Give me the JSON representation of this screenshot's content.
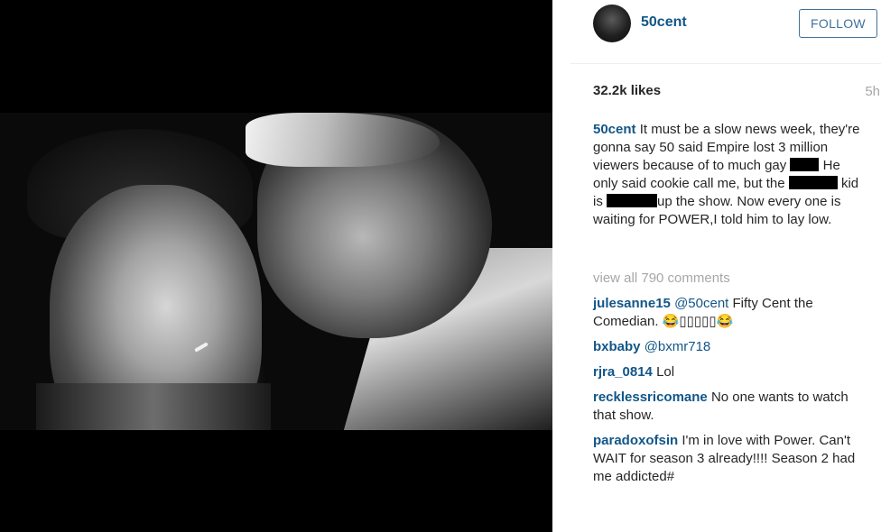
{
  "post": {
    "author": "50cent",
    "follow_label": "FOLLOW",
    "likes": "32.2k likes",
    "time_ago": "5h",
    "caption": {
      "username": "50cent",
      "part1": "It must be a slow news week, they're gonna say 50 said Empire lost 3 million viewers because of to much gay",
      "part2": "He only said cookie call me, but the",
      "part3": "kid is",
      "part4": "up the show. Now every one is waiting for POWER,I told him to lay low."
    }
  },
  "comments_section": {
    "view_all_label": "view all 790 comments",
    "items": [
      {
        "username": "julesanne15",
        "mention": "@50cent",
        "text": "Fifty Cent the Comedian. 😂▯▯▯▯▯😂"
      },
      {
        "username": "bxbaby",
        "mention": "@bxmr718",
        "text": ""
      },
      {
        "username": "rjra_0814",
        "mention": "",
        "text": "Lol"
      },
      {
        "username": "recklessricomane",
        "mention": "",
        "text": "No one wants to watch that show."
      },
      {
        "username": "paradoxofsin",
        "mention": "",
        "text": "I'm in love with Power. Can't WAIT for season 3 already!!!! Season 2 had me addicted#"
      }
    ]
  },
  "colors": {
    "username_blue": "#125688",
    "follow_blue": "#3f729b",
    "muted_gray": "#a5a7aa",
    "text": "#262626"
  }
}
